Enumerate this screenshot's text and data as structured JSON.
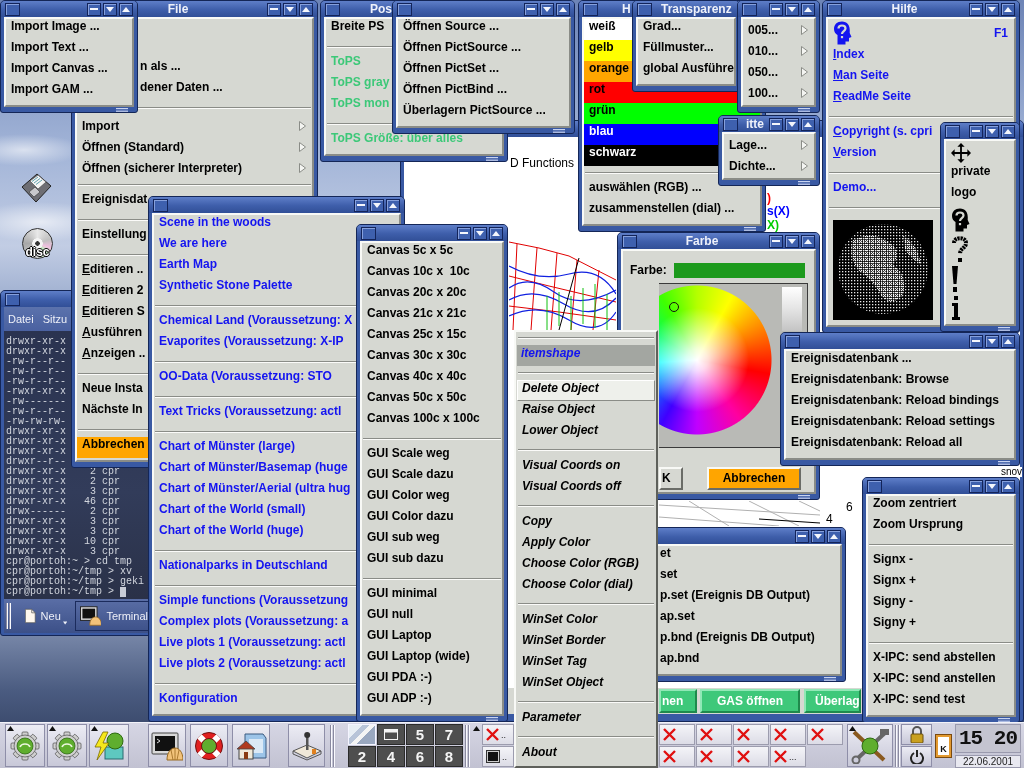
{
  "desktop": {
    "cd_badge": "disc"
  },
  "plot_window": {
    "caption": "D Functions",
    "legend": [
      {
        "label": ")",
        "color": "#ff0000"
      },
      {
        "label": "s(X)",
        "color": "#0000ff"
      },
      {
        "label": "X)",
        "color": "#00cc00"
      }
    ],
    "ticks": [
      "6",
      "4"
    ],
    "side_label": "snov",
    "buttons": [
      "nen",
      "GAS öffnen",
      "Überlag"
    ]
  },
  "terminal": {
    "menu": [
      "Datei",
      "Sitzu"
    ],
    "lines": [
      "drwxr-xr-x",
      "drwxr-xr-x",
      "-rw-r--r--",
      "-rw-r--r--",
      "-rw-r--r--",
      "-rwxr-xr-x",
      "-rw-------",
      "-rw-r--r--",
      "-rw-rw-rw-",
      "drwxr-xr-x",
      "drwxr-xr-x",
      "drwxr-xr-x",
      "drwxr--r--",
      "drwxr-xr-x    2 cpr",
      "drwxr-xr-x    2 cpr",
      "drwxr-xr-x    3 cpr",
      "drwxr-xr-x   46 cpr",
      "drwx------    2 cpr",
      "drwxr-xr-x    3 cpr",
      "drwxr-xr-x    3 cpr",
      "drwxr-xr-x   10 cpr",
      "drwxr-xr-x    3 cpr",
      "cpr@portoh:~ > cd tmp",
      "cpr@portoh:~/tmp > xv",
      "cpr@portoh:~/tmp > geki",
      "cpr@portoh:~/tmp >"
    ],
    "cursor": true,
    "toolbar": [
      {
        "label": "Neu",
        "menu": true
      },
      {
        "label": "Terminal",
        "menu": false
      }
    ]
  },
  "windows": [
    {
      "kind": "menu",
      "sections": [
        [
          {
            "kind": "command",
            "label": "Import Image ..."
          },
          {
            "kind": "command",
            "label": "Import Text ..."
          },
          {
            "kind": "command",
            "label": "Import Canvas ..."
          },
          {
            "kind": "command",
            "label": "Import GAM ..."
          }
        ]
      ]
    },
    {
      "kind": "menu",
      "title": "File",
      "sections": [
        [
          {
            "kind": "fragment",
            "label": "n als ...",
            "mnemonic": false
          },
          {
            "kind": "fragment",
            "label": "dener Daten ...",
            "mnemonic": false
          }
        ],
        [
          {
            "kind": "cascade",
            "label": "Import",
            "mnemonic": false
          },
          {
            "kind": "cascade",
            "label": "Öffnen (Standard)",
            "mnemonic": false
          },
          {
            "kind": "cascade",
            "label": "Öffnen (sicherer Interpreter)",
            "mnemonic": false
          }
        ],
        [
          {
            "kind": "command",
            "label": "Ereignisdat",
            "mnemonic": false
          }
        ],
        [
          {
            "kind": "command",
            "label": "Einstellung",
            "mnemonic": false
          }
        ],
        [
          {
            "kind": "command",
            "label": "Editieren ..",
            "mnemonic": true
          },
          {
            "kind": "command",
            "label": "Editieren 2",
            "mnemonic": true
          },
          {
            "kind": "command",
            "label": "Editieren S",
            "mnemonic": true
          },
          {
            "kind": "command",
            "label": "Ausführen",
            "mnemonic": true
          },
          {
            "kind": "command",
            "label": "Anzeigen ..",
            "mnemonic": true
          }
        ],
        [
          {
            "kind": "command",
            "label": "Neue Insta",
            "mnemonic": false
          },
          {
            "kind": "command",
            "label": "Nächste In",
            "mnemonic": false
          }
        ],
        [
          {
            "kind": "swatch",
            "label": "Abbrechen",
            "color": "#ffa500"
          }
        ]
      ]
    },
    {
      "kind": "menu",
      "title": "Pos",
      "sections": [
        [
          {
            "kind": "command",
            "label": "Breite PS"
          }
        ],
        [
          {
            "kind": "command",
            "label": "ToPS",
            "color": "#3cc878"
          },
          {
            "kind": "command",
            "label": "ToPS gray",
            "color": "#3cc878"
          },
          {
            "kind": "command",
            "label": "ToPS mon",
            "color": "#3cc878"
          }
        ],
        [
          {
            "kind": "command",
            "label": "ToPS Größe: über alles",
            "color": "#3cc878"
          }
        ]
      ]
    },
    {
      "kind": "menu",
      "sections": [
        [
          {
            "kind": "command",
            "label": "Öffnen Source ..."
          },
          {
            "kind": "command",
            "label": "Öffnen PictSource ..."
          },
          {
            "kind": "command",
            "label": "Öffnen PictSet ..."
          },
          {
            "kind": "command",
            "label": "Öffnen PictBind ..."
          },
          {
            "kind": "command",
            "label": "Überlagern PictSource ..."
          }
        ]
      ]
    },
    {
      "kind": "menu",
      "title": "H",
      "sections": [
        [
          {
            "kind": "swatch",
            "label": "weiß",
            "color": "#ffffff"
          },
          {
            "kind": "swatch",
            "label": "gelb",
            "color": "#ffff00"
          },
          {
            "kind": "swatch",
            "label": "orange",
            "color": "#ffa500"
          },
          {
            "kind": "swatch",
            "label": "rot",
            "color": "#ff0000"
          },
          {
            "kind": "swatch",
            "label": "grün",
            "color": "#00ff00"
          },
          {
            "kind": "swatch",
            "label": "blau",
            "color": "#0000ff"
          },
          {
            "kind": "swatch",
            "label": "schwarz",
            "color": "#000000"
          }
        ],
        [
          {
            "kind": "command",
            "label": "auswählen (RGB) ..."
          },
          {
            "kind": "command",
            "label": "zusammenstellen (dial) ..."
          }
        ]
      ]
    },
    {
      "kind": "menu",
      "title": "Transparenz",
      "sections": [
        [
          {
            "kind": "command",
            "label": "Grad..."
          },
          {
            "kind": "command",
            "label": "Füllmuster..."
          },
          {
            "kind": "command",
            "label": "global Ausführe"
          }
        ]
      ]
    },
    {
      "kind": "menu",
      "sections": [
        [
          {
            "kind": "cascade",
            "label": "005..."
          },
          {
            "kind": "cascade",
            "label": "010..."
          },
          {
            "kind": "cascade",
            "label": "050..."
          },
          {
            "kind": "cascade",
            "label": "100..."
          }
        ]
      ]
    },
    {
      "kind": "links",
      "title": "Hilfe",
      "sections": [
        [
          {
            "kind": "bitmap",
            "accelerator": "F1"
          },
          {
            "kind": "command",
            "label": "Index",
            "mnemonic": true
          },
          {
            "kind": "command",
            "label": "Man Seite",
            "mnemonic": true
          },
          {
            "kind": "command",
            "label": "ReadMe Seite",
            "mnemonic": true
          }
        ],
        [
          {
            "kind": "command",
            "label": "Copyright (s. cpri",
            "mnemonic": true
          },
          {
            "kind": "command",
            "label": "Version",
            "mnemonic": true
          }
        ],
        [
          {
            "kind": "command",
            "label": "Demo...",
            "mnemonic": false
          }
        ],
        [
          {
            "kind": "image"
          }
        ]
      ]
    },
    {
      "kind": "menu",
      "title": "itte",
      "sections": [
        [
          {
            "kind": "cascade",
            "label": "Lage..."
          },
          {
            "kind": "cascade",
            "label": "Dichte..."
          }
        ]
      ]
    },
    {
      "kind": "menu",
      "sections": [
        [
          {
            "kind": "bitmap"
          },
          {
            "kind": "command",
            "label": "private"
          },
          {
            "kind": "command",
            "label": "logo"
          },
          {
            "kind": "bitmap"
          },
          {
            "kind": "bitmap"
          },
          {
            "kind": "bitmap"
          },
          {
            "kind": "bitmap"
          }
        ]
      ]
    },
    {
      "kind": "links",
      "sections": [
        [
          {
            "kind": "command",
            "label": "Scene in the woods"
          },
          {
            "kind": "command",
            "label": "We are here"
          },
          {
            "kind": "command",
            "label": "Earth Map"
          },
          {
            "kind": "command",
            "label": "Synthetic Stone Palette"
          }
        ],
        [
          {
            "kind": "command",
            "label": "Chemical Land (Voraussetzung: X"
          },
          {
            "kind": "command",
            "label": "Evaporites (Voraussetzung: X-IP"
          }
        ],
        [
          {
            "kind": "command",
            "label": "OO-Data (Voraussetzung: STO"
          }
        ],
        [
          {
            "kind": "command",
            "label": "Text Tricks (Voraussetzung: actl"
          }
        ],
        [
          {
            "kind": "command",
            "label": "Chart of Münster (large)"
          },
          {
            "kind": "command",
            "label": "Chart of Münster/Basemap (huge"
          },
          {
            "kind": "command",
            "label": "Chart of Münster/Aerial (ultra hug"
          },
          {
            "kind": "command",
            "label": "Chart of the World (small)"
          },
          {
            "kind": "command",
            "label": "Chart of the World (huge)"
          }
        ],
        [
          {
            "kind": "command",
            "label": "Nationalparks in Deutschland"
          }
        ],
        [
          {
            "kind": "command",
            "label": "Simple functions (Voraussetzung"
          },
          {
            "kind": "command",
            "label": "Complex plots (Voraussetzung: a"
          },
          {
            "kind": "command",
            "label": "Live plots 1 (Voraussetzung: actl"
          },
          {
            "kind": "command",
            "label": "Live plots 2 (Voraussetzung: actl"
          }
        ],
        [
          {
            "kind": "command",
            "label": "Konfiguration"
          }
        ]
      ]
    },
    {
      "kind": "menu",
      "sections": [
        [
          {
            "kind": "command",
            "label": "Canvas 5c x 5c"
          },
          {
            "kind": "command",
            "label": "Canvas 10c x  10c"
          },
          {
            "kind": "command",
            "label": "Canvas 20c x 20c"
          },
          {
            "kind": "command",
            "label": "Canvas 21c x 21c"
          },
          {
            "kind": "command",
            "label": "Canvas 25c x 15c"
          },
          {
            "kind": "command",
            "label": "Canvas 30c x 30c"
          },
          {
            "kind": "command",
            "label": "Canvas 40c x 40c"
          },
          {
            "kind": "command",
            "label": "Canvas 50c x 50c"
          },
          {
            "kind": "command",
            "label": "Canvas 100c x 100c"
          }
        ],
        [
          {
            "kind": "command",
            "label": "GUI Scale weg"
          },
          {
            "kind": "command",
            "label": "GUI Scale dazu"
          },
          {
            "kind": "command",
            "label": "GUI Color weg"
          },
          {
            "kind": "command",
            "label": "GUI Color dazu"
          },
          {
            "kind": "command",
            "label": "GUI sub weg"
          },
          {
            "kind": "command",
            "label": "GUI sub dazu"
          }
        ],
        [
          {
            "kind": "command",
            "label": "GUI minimal"
          },
          {
            "kind": "command",
            "label": "GUI null"
          },
          {
            "kind": "command",
            "label": "GUI Laptop"
          },
          {
            "kind": "command",
            "label": "GUI Laptop (wide)"
          },
          {
            "kind": "command",
            "label": "GUI PDA :-)"
          },
          {
            "kind": "command",
            "label": "GUI ADP :-)"
          }
        ]
      ]
    },
    {
      "kind": "color",
      "title": "Farbe",
      "label": "Farbe:",
      "color": "#1c9a1c",
      "actions": [
        {
          "label": "K"
        },
        {
          "label": "Abbrechen",
          "color": "#ffa500"
        }
      ]
    },
    {
      "kind": "menu",
      "sections": [
        [
          {
            "kind": "command",
            "label": "Ereignisdatenbank ..."
          },
          {
            "kind": "command",
            "label": "Ereignisdatenbank: Browse"
          },
          {
            "kind": "command",
            "label": "Ereignisdatenbank: Reload bindings"
          },
          {
            "kind": "command",
            "label": "Ereignisdatenbank: Reload settings"
          },
          {
            "kind": "command",
            "label": "Ereignisdatenbank: Reload all"
          }
        ]
      ]
    },
    {
      "kind": "menu",
      "sections": [
        [
          {
            "kind": "command",
            "label": "Zoom zentriert"
          },
          {
            "kind": "command",
            "label": "Zoom Ursprung"
          }
        ],
        [
          {
            "kind": "command",
            "label": "Signx -"
          },
          {
            "kind": "command",
            "label": "Signx +"
          },
          {
            "kind": "command",
            "label": "Signy -"
          },
          {
            "kind": "command",
            "label": "Signy +"
          }
        ],
        [
          {
            "kind": "command",
            "label": "X-IPC: send abstellen"
          },
          {
            "kind": "command",
            "label": "X-IPC: send anstellen"
          },
          {
            "kind": "command",
            "label": "X-IPC: send test"
          }
        ]
      ]
    },
    {
      "kind": "menu",
      "sections": [
        [
          {
            "kind": "fragment",
            "label": "et"
          },
          {
            "kind": "fragment",
            "label": "set"
          },
          {
            "kind": "fragment",
            "label": "p.set (Ereignis DB Output)"
          },
          {
            "kind": "fragment",
            "label": "ap.set"
          },
          {
            "kind": "fragment",
            "label": "p.bnd (Ereignis DB Output)"
          },
          {
            "kind": "fragment",
            "label": "ap.bnd"
          }
        ]
      ]
    }
  ],
  "taskbar": {
    "launchers": [
      {
        "menu": true
      },
      {
        "menu": true
      },
      {
        "menu": true
      },
      {
        "menu": false
      },
      {
        "menu": false
      },
      {
        "menu": false
      },
      {
        "menu": false
      }
    ],
    "pager": [
      {
        "kind": "thumbnail",
        "selected": true
      },
      {
        "kind": "window",
        "selected": false
      },
      {
        "kind": "number",
        "label": "5",
        "selected": false
      },
      {
        "kind": "number",
        "label": "7",
        "selected": false
      },
      {
        "kind": "number",
        "label": "2",
        "selected": false
      },
      {
        "kind": "number",
        "label": "4",
        "selected": false
      },
      {
        "kind": "number",
        "label": "6",
        "selected": false
      },
      {
        "kind": "number",
        "label": "8",
        "selected": false
      }
    ],
    "tasks_left": [
      {
        "kind": "unknown",
        "label": ".."
      },
      {
        "kind": "console",
        "label": ".."
      }
    ],
    "tasks_right": [
      {
        "kind": "unknown"
      },
      {
        "kind": "unknown"
      },
      {
        "kind": "unknown"
      },
      {
        "kind": "unknown"
      },
      {
        "kind": "unknown"
      },
      {
        "kind": "unknown"
      },
      {
        "kind": "unknown"
      },
      {
        "kind": "unknown"
      },
      {
        "kind": "unknown",
        "label": "..."
      }
    ],
    "applet_menu": true,
    "clipboard_badge": "K",
    "clock": {
      "time": "15 20",
      "date": "22.06.2001"
    }
  },
  "context_menu": {
    "tearoff": true,
    "sections": [
      [
        {
          "kind": "header",
          "label": "itemshape",
          "active": false
        }
      ],
      [
        {
          "kind": "command",
          "label": "Delete Object",
          "active": true
        },
        {
          "kind": "command",
          "label": "Raise Object",
          "active": false
        },
        {
          "kind": "command",
          "label": "Lower Object",
          "active": false
        }
      ],
      [
        {
          "kind": "command",
          "label": "Visual Coords on",
          "active": false
        },
        {
          "kind": "command",
          "label": "Visual Coords off",
          "active": false
        }
      ],
      [
        {
          "kind": "command",
          "label": "Copy",
          "active": false
        },
        {
          "kind": "command",
          "label": "Apply Color",
          "active": false
        },
        {
          "kind": "command",
          "label": "Choose Color (RGB)",
          "active": false
        },
        {
          "kind": "command",
          "label": "Choose Color (dial)",
          "active": false
        }
      ],
      [
        {
          "kind": "command",
          "label": "WinSet Color",
          "active": false
        },
        {
          "kind": "command",
          "label": "WinSet Border",
          "active": false
        },
        {
          "kind": "command",
          "label": "WinSet Tag",
          "active": false
        },
        {
          "kind": "command",
          "label": "WinSet Object",
          "active": false
        }
      ],
      [
        {
          "kind": "command",
          "label": "Parameter",
          "active": false
        }
      ],
      [
        {
          "kind": "command",
          "label": "About",
          "active": false
        }
      ]
    ]
  }
}
